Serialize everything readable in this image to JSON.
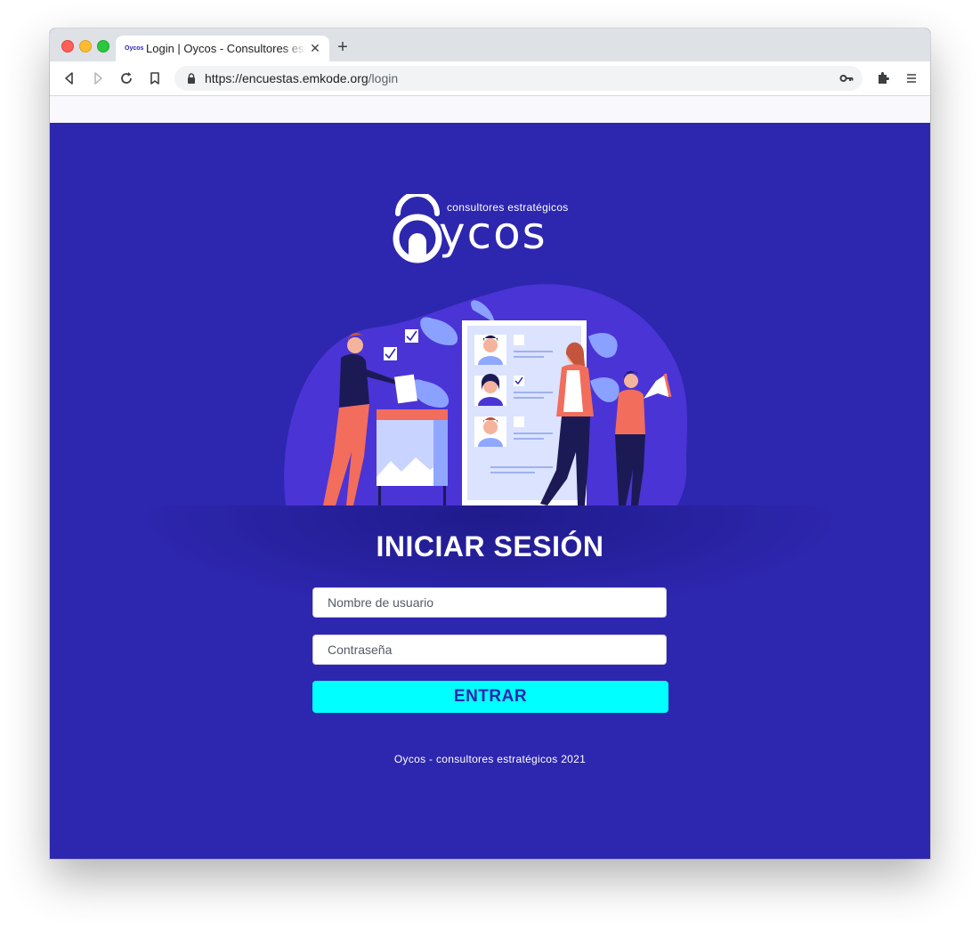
{
  "browser": {
    "tab_title": "Login | Oycos - Consultores estratégicos",
    "favicon_text": "Oycos",
    "url_host": "https://encuestas.emkode.org",
    "url_path": "/login"
  },
  "brand": {
    "tagline": "consultores estratégicos",
    "wordmark": "ycos"
  },
  "login": {
    "heading": "INICIAR SESIÓN",
    "username_placeholder": "Nombre de usuario",
    "password_placeholder": "Contraseña",
    "submit_label": "ENTRAR"
  },
  "footer": {
    "text": "Oycos - consultores estratégicos 2021"
  },
  "colors": {
    "page_background": "#2d26ae",
    "button_background": "#00ffff",
    "button_text": "#2d26ae",
    "illustration_accent": "#f26d5b"
  }
}
